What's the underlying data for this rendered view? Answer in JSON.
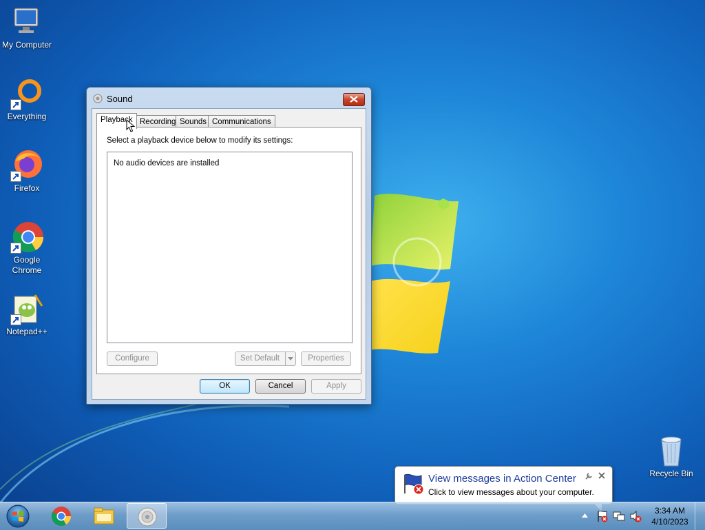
{
  "desktop": {
    "icons": [
      {
        "label": "My Computer",
        "icon": "computer-icon"
      },
      {
        "label": "Everything",
        "icon": "everything-icon"
      },
      {
        "label": "Firefox",
        "icon": "firefox-icon"
      },
      {
        "label": "Google Chrome",
        "icon": "chrome-icon"
      },
      {
        "label": "Notepad++",
        "icon": "notepadpp-icon"
      },
      {
        "label": "Recycle Bin",
        "icon": "recycle-bin-icon"
      }
    ]
  },
  "sound_dialog": {
    "title": "Sound",
    "tabs": [
      {
        "label": "Playback",
        "active": true
      },
      {
        "label": "Recording",
        "active": false
      },
      {
        "label": "Sounds",
        "active": false
      },
      {
        "label": "Communications",
        "active": false
      }
    ],
    "instruction": "Select a playback device below to modify its settings:",
    "empty_message": "No audio devices are installed",
    "buttons": {
      "configure": "Configure",
      "set_default": "Set Default",
      "properties": "Properties",
      "ok": "OK",
      "cancel": "Cancel",
      "apply": "Apply"
    }
  },
  "balloon": {
    "title": "View messages in Action Center",
    "text": "Click to view messages about your computer."
  },
  "taskbar": {
    "pinned": [
      "chrome-icon",
      "explorer-icon",
      "sound-icon"
    ],
    "clock": {
      "time": "3:34 AM",
      "date": "4/10/2023"
    }
  },
  "colors": {
    "balloon_title": "#1e3c9c",
    "close_button": "#c7452d"
  }
}
